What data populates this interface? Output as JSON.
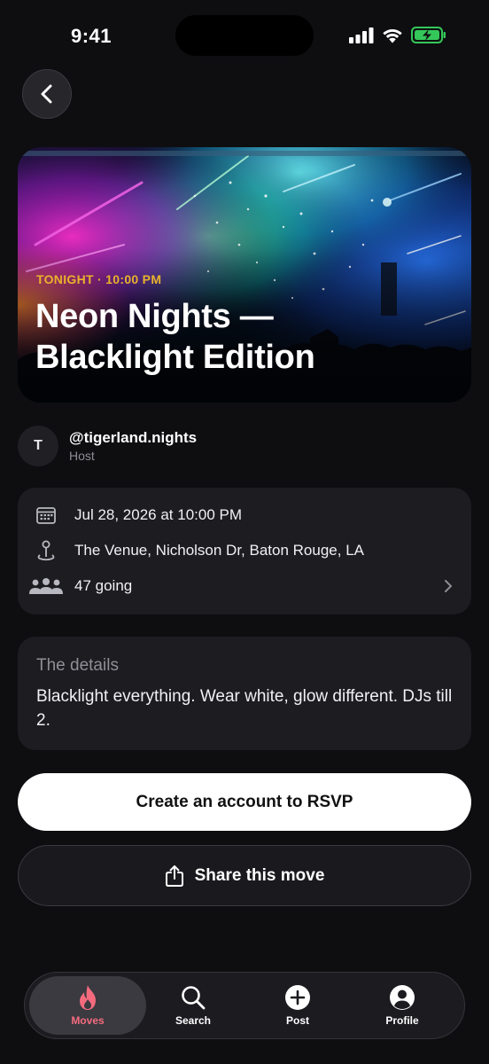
{
  "status_bar": {
    "time": "9:41"
  },
  "hero": {
    "kicker": "TONIGHT · 10:00 PM",
    "title": "Neon Nights — Blacklight Edition"
  },
  "host": {
    "initial": "T",
    "handle": "@tigerland.nights",
    "role": "Host"
  },
  "info": {
    "date": "Jul 28, 2026 at 10:00 PM",
    "location": "The Venue, Nicholson Dr, Baton Rouge, LA",
    "attendees": "47 going"
  },
  "details": {
    "label": "The details",
    "body": "Blacklight everything. Wear white, glow different. DJs till 2."
  },
  "actions": {
    "rsvp_label": "Create an account to RSVP",
    "share_label": "Share this move"
  },
  "nav": {
    "items": [
      {
        "label": "Moves",
        "icon": "flame-icon",
        "active": true
      },
      {
        "label": "Search",
        "icon": "search-icon",
        "active": false
      },
      {
        "label": "Post",
        "icon": "plus-circle-icon",
        "active": false
      },
      {
        "label": "Profile",
        "icon": "profile-icon",
        "active": false
      }
    ]
  },
  "colors": {
    "background": "#0e0e11",
    "card": "#1c1c21",
    "kicker": "#e9b22b",
    "active_nav": "#f46b7e",
    "battery": "#34c759"
  }
}
